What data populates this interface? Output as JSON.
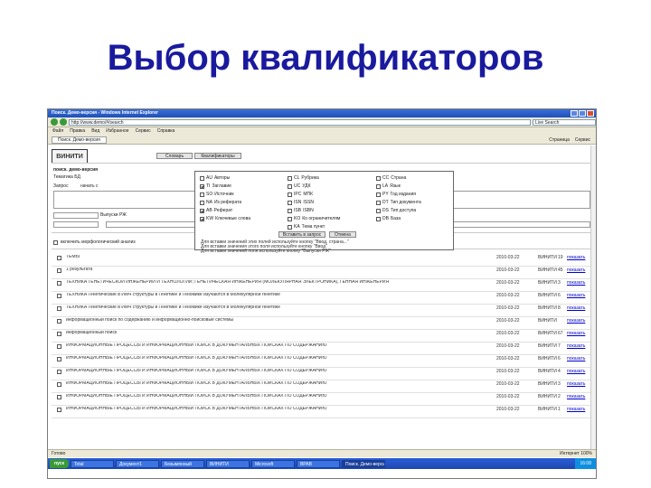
{
  "slide": {
    "title": "Выбор квалификаторов"
  },
  "browser": {
    "window_title": "Поиск. Демо-версия - Windows Internet Explorer",
    "address": "http://www.demo/#/search",
    "search_placeholder": "Live Search",
    "menu": [
      "Файл",
      "Правка",
      "Вид",
      "Избранное",
      "Сервис",
      "Справка"
    ],
    "tab_label": "Поиск. Демо-версия",
    "tab_tools": [
      "Страница",
      "Сервис"
    ]
  },
  "page": {
    "logo": "ВИНИТИ",
    "buttons": [
      "Словарь",
      "Квалификаторы"
    ],
    "heading": "поиск. демо-версия",
    "subheading": "Тематика БД",
    "query_label": "Запрос",
    "query_value": "начать с",
    "year_label": "Выпуски РЖ",
    "morph_label": "включить морфологический анализ"
  },
  "qualifiers": {
    "items": [
      {
        "code": "AU",
        "label": "Авторы",
        "checked": false
      },
      {
        "code": "TI",
        "label": "Заглавие",
        "checked": true
      },
      {
        "code": "SO",
        "label": "Источник",
        "checked": false
      },
      {
        "code": "NA",
        "label": "Из реферата",
        "checked": false
      },
      {
        "code": "AB",
        "label": "Реферат",
        "checked": true
      },
      {
        "code": "KW",
        "label": "Ключевые слова",
        "checked": true
      },
      {
        "code": "CL",
        "label": "Рубрика",
        "checked": false
      },
      {
        "code": "UC",
        "label": "УДК",
        "checked": false
      },
      {
        "code": "IPC",
        "label": "МПК",
        "checked": false
      },
      {
        "code": "ISN",
        "label": "ISSN",
        "checked": false
      },
      {
        "code": "ISB",
        "label": "ISBN",
        "checked": false
      },
      {
        "code": "KO",
        "label": "Ко ограничителям",
        "checked": false
      },
      {
        "code": "CC",
        "label": "Страна",
        "checked": false
      },
      {
        "code": "LA",
        "label": "Язык",
        "checked": false
      },
      {
        "code": "PY",
        "label": "Год издания",
        "checked": false
      },
      {
        "code": "DT",
        "label": "Тип документа",
        "checked": false
      },
      {
        "code": "DS",
        "label": "Тип доступа",
        "checked": false
      },
      {
        "code": "DB",
        "label": "База",
        "checked": false
      },
      {
        "code": "KA",
        "label": "Тема пункт",
        "checked": false
      }
    ],
    "buttons": [
      "Вставить в запрос",
      "Отмена"
    ],
    "notes": [
      "Для вставки значений этих полей используйте кнопку \"Ввод, страна...\"",
      "Для вставки значения этого поля используйте кнопку \"Ввод\"",
      "Для вставки значений поля используйте кнопку \"Выпуски РЖ\""
    ]
  },
  "results": [
    {
      "text": "ТЕМЫ",
      "date": "2010-03-22",
      "src": "ВИНИТИ",
      "num": "19",
      "show": "показать"
    },
    {
      "text": "1 результата",
      "date": "2010-03-22",
      "src": "ВИНИТИ",
      "num": "45",
      "show": "показать"
    },
    {
      "text": "ТЕХНИКА ГЕНЕТИЧЕСКОЙ ИНЖЕНЕРИИ И ТЕХНОЛОГИИ; ГЕНЕТИЧЕСКАЯ ИНЖЕНЕРИЯ (МОЛЕКУЛЯРНАЯ ЭЛЕКТРОНИКА), ГЕННАЯ ИНЖЕНЕРИЯ",
      "date": "2010-03-22",
      "src": "ВИНИТИ",
      "num": "3",
      "show": "показать"
    },
    {
      "text": "ТЕХНИКА Генетические в ИМЧ структуры в Генетике и Геномике изучаются в Молекулярной генетике",
      "date": "2010-03-22",
      "src": "ВИНИТИ",
      "num": "6",
      "show": "показать"
    },
    {
      "text": "ТЕХНИКА Генетические в ИМЧ структуры в Генетике и Геномике изучаются в Молекулярной генетике",
      "date": "2010-03-22",
      "src": "ВИНИТИ",
      "num": "8",
      "show": "показать"
    },
    {
      "text": "информационный поиск по содержанию и информационно-поисковые системы",
      "date": "2010-03-22",
      "src": "ВИНИТИ",
      "num": "",
      "show": "показать"
    },
    {
      "text": "информационный поиск",
      "date": "2010-03-22",
      "src": "ВИНИТИ",
      "num": "67",
      "show": "показать"
    },
    {
      "text": "ИНФОРМАЦИОННЫЕ ПРОЦЕССЫ И ИНФОРМАЦИОННЫЙ ПОИСК В ДОКУМЕНТАЛЬНЫХ ПОИСКАХ ПО СОДЕРЖАНИЮ",
      "date": "2010-03-22",
      "src": "ВИНИТИ",
      "num": "7",
      "show": "показать"
    },
    {
      "text": "ИНФОРМАЦИОННЫЕ ПРОЦЕССЫ И ИНФОРМАЦИОННЫЙ ПОИСК В ДОКУМЕНТАЛЬНЫХ ПОИСКАХ ПО СОДЕРЖАНИЮ",
      "date": "2010-03-22",
      "src": "ВИНИТИ",
      "num": "6",
      "show": "показать"
    },
    {
      "text": "ИНФОРМАЦИОННЫЕ ПРОЦЕССЫ И ИНФОРМАЦИОННЫЙ ПОИСК В ДОКУМЕНТАЛЬНЫХ ПОИСКАХ ПО СОДЕРЖАНИЮ",
      "date": "2010-03-22",
      "src": "ВИНИТИ",
      "num": "4",
      "show": "показать"
    },
    {
      "text": "ИНФОРМАЦИОННЫЕ ПРОЦЕССЫ И ИНФОРМАЦИОННЫЙ ПОИСК В ДОКУМЕНТАЛЬНЫХ ПОИСКАХ ПО СОДЕРЖАНИЮ",
      "date": "2010-03-22",
      "src": "ВИНИТИ",
      "num": "3",
      "show": "показать"
    },
    {
      "text": "ИНФОРМАЦИОННЫЕ ПРОЦЕССЫ И ИНФОРМАЦИОННЫЙ ПОИСК В ДОКУМЕНТАЛЬНЫХ ПОИСКАХ ПО СОДЕРЖАНИЮ",
      "date": "2010-03-22",
      "src": "ВИНИТИ",
      "num": "2",
      "show": "показать"
    },
    {
      "text": "ИНФОРМАЦИОННЫЕ ПРОЦЕССЫ И ИНФОРМАЦИОННЫЙ ПОИСК В ДОКУМЕНТАЛЬНЫХ ПОИСКАХ ПО СОДЕРЖАНИЮ",
      "date": "2010-03-22",
      "src": "ВИНИТИ",
      "num": "1",
      "show": "показать"
    }
  ],
  "status": {
    "left": "Готово",
    "right": "Интернет",
    "zoom": "100%"
  },
  "taskbar": {
    "start": "пуск",
    "tasks": [
      "Total",
      "Документ1",
      "Безымянный",
      "ВИНИТИ",
      "Microsoft",
      "ВРАВ",
      "Поиск. Демо-версия"
    ],
    "clock": "16:08"
  }
}
